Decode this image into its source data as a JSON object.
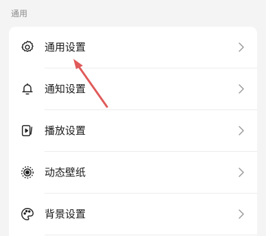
{
  "section": {
    "title": "通用"
  },
  "settings": {
    "items": [
      {
        "label": "通用设置",
        "icon": "gear-icon"
      },
      {
        "label": "通知设置",
        "icon": "bell-icon"
      },
      {
        "label": "播放设置",
        "icon": "play-settings-icon"
      },
      {
        "label": "动态壁纸",
        "icon": "live-wallpaper-icon"
      },
      {
        "label": "背景设置",
        "icon": "palette-icon"
      }
    ]
  },
  "annotation": {
    "arrow_color": "#e05a5a",
    "points_to": "通用设置"
  },
  "colors": {
    "background": "#f4f4f4",
    "card": "#ffffff",
    "text": "#1a1a1a",
    "muted": "#8c8c8c",
    "chevron": "#9a9a9a"
  }
}
